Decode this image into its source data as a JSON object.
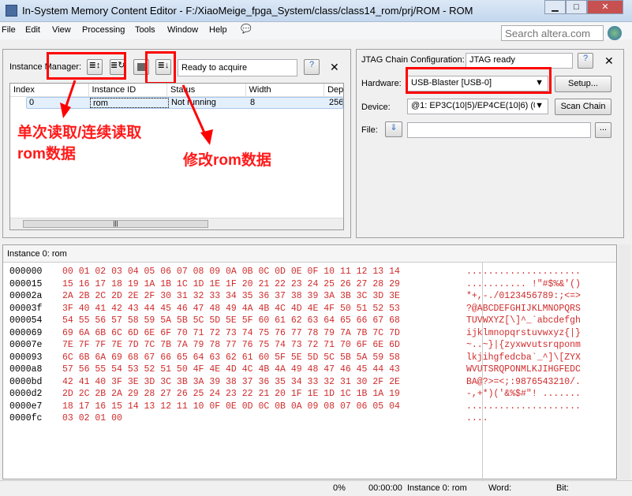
{
  "window": {
    "title": "In-System Memory Content Editor - F:/XiaoMeige_fpga_System/class/class14_rom/prj/ROM - ROM",
    "min": "▁",
    "max": "□",
    "close": "✕"
  },
  "menu": [
    "File",
    "Edit",
    "View",
    "Processing",
    "Tools",
    "Window",
    "Help"
  ],
  "search": {
    "placeholder": "Search altera.com"
  },
  "instance_manager": {
    "label": "Instance Manager:",
    "status": "Ready to acquire",
    "columns": [
      "Index",
      "Instance ID",
      "Status",
      "Width",
      "Dep"
    ],
    "rows": [
      {
        "index": "0",
        "id": "rom",
        "status": "Not running",
        "width": "8",
        "depth": "256"
      }
    ]
  },
  "jtag": {
    "label": "JTAG Chain Configuration:",
    "status": "JTAG ready",
    "hardware_label": "Hardware:",
    "hardware": "USB-Blaster [USB-0]",
    "setup": "Setup...",
    "device_label": "Device:",
    "device": "@1: EP3C(10|5)/EP4CE(10|6) (0",
    "scan": "Scan Chain",
    "file_label": "File:",
    "browse": "..."
  },
  "annotations": {
    "read": "单次读取/连续读取\nrom数据",
    "edit": "修改rom数据",
    "color": "#ff0000"
  },
  "memory": {
    "title": "Instance 0: rom",
    "rows": [
      {
        "addr": "000000",
        "hex": "00 01 02 03 04 05 06 07 08 09 0A 0B 0C 0D 0E 0F 10 11 12 13 14",
        "ascii": "....................."
      },
      {
        "addr": "000015",
        "hex": "15 16 17 18 19 1A 1B 1C 1D 1E 1F 20 21 22 23 24 25 26 27 28 29",
        "ascii": "........... !\"#$%&'()"
      },
      {
        "addr": "00002a",
        "hex": "2A 2B 2C 2D 2E 2F 30 31 32 33 34 35 36 37 38 39 3A 3B 3C 3D 3E",
        "ascii": "*+,-./0123456789:;<=>"
      },
      {
        "addr": "00003f",
        "hex": "3F 40 41 42 43 44 45 46 47 48 49 4A 4B 4C 4D 4E 4F 50 51 52 53",
        "ascii": "?@ABCDEFGHIJKLMNOPQRS"
      },
      {
        "addr": "000054",
        "hex": "54 55 56 57 58 59 5A 5B 5C 5D 5E 5F 60 61 62 63 64 65 66 67 68",
        "ascii": "TUVWXYZ[\\]^_`abcdefgh"
      },
      {
        "addr": "000069",
        "hex": "69 6A 6B 6C 6D 6E 6F 70 71 72 73 74 75 76 77 78 79 7A 7B 7C 7D",
        "ascii": "ijklmnopqrstuvwxyz{|}"
      },
      {
        "addr": "00007e",
        "hex": "7E 7F 7F 7E 7D 7C 7B 7A 79 78 77 76 75 74 73 72 71 70 6F 6E 6D",
        "ascii": "~..~}|{zyxwvutsrqponm"
      },
      {
        "addr": "000093",
        "hex": "6C 6B 6A 69 68 67 66 65 64 63 62 61 60 5F 5E 5D 5C 5B 5A 59 58",
        "ascii": "lkjihgfedcba`_^]\\[ZYX"
      },
      {
        "addr": "0000a8",
        "hex": "57 56 55 54 53 52 51 50 4F 4E 4D 4C 4B 4A 49 48 47 46 45 44 43",
        "ascii": "WVUTSRQPONMLKJIHGFEDC"
      },
      {
        "addr": "0000bd",
        "hex": "42 41 40 3F 3E 3D 3C 3B 3A 39 38 37 36 35 34 33 32 31 30 2F 2E",
        "ascii": "BA@?>=<;:9876543210/."
      },
      {
        "addr": "0000d2",
        "hex": "2D 2C 2B 2A 29 28 27 26 25 24 23 22 21 20 1F 1E 1D 1C 1B 1A 19",
        "ascii": "-,+*)('&%$#\"! ......."
      },
      {
        "addr": "0000e7",
        "hex": "18 17 16 15 14 13 12 11 10 0F 0E 0D 0C 0B 0A 09 08 07 06 05 04",
        "ascii": "....................."
      },
      {
        "addr": "0000fc",
        "hex": "03 02 01 00",
        "ascii": "...."
      }
    ]
  },
  "statusbar": {
    "progress": "0%",
    "time": "00:00:00",
    "instance": "Instance 0: rom",
    "word_label": "Word:",
    "bit_label": "Bit:"
  }
}
